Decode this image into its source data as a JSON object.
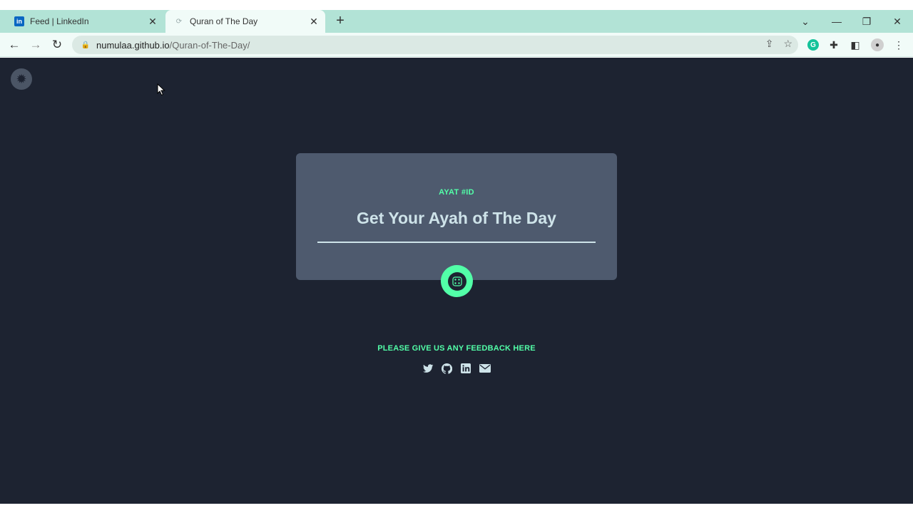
{
  "browser": {
    "tabs": [
      {
        "title": "Feed | LinkedIn",
        "favicon": "linkedin-icon",
        "active": false
      },
      {
        "title": "Quran of The Day",
        "favicon": "loading-icon",
        "active": true
      }
    ],
    "address": {
      "host": "numulaa.github.io",
      "path": "/Quran-of-The-Day/"
    }
  },
  "page": {
    "ayat_id": "AYAT #ID",
    "headline": "Get Your Ayah of The Day",
    "feedback": "PLEASE GIVE US ANY FEEDBACK HERE",
    "socials": [
      "twitter-icon",
      "github-icon",
      "linkedin-icon",
      "email-icon"
    ]
  },
  "colors": {
    "accent": "#52ffa8",
    "background": "#1d2331",
    "card": "#4e5a6e",
    "text": "#cee3e9",
    "tabbar": "#b2e3d6"
  }
}
